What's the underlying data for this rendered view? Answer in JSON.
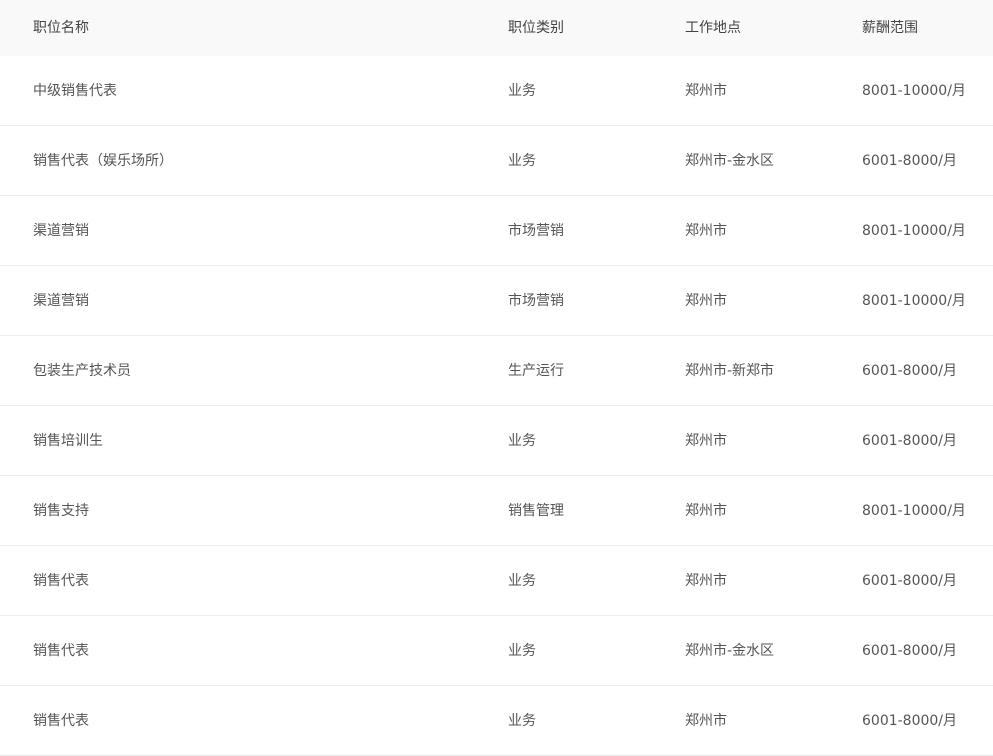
{
  "table": {
    "headers": {
      "title": "职位名称",
      "category": "职位类别",
      "location": "工作地点",
      "salary": "薪酬范围"
    },
    "rows": [
      {
        "title": "中级销售代表",
        "category": "业务",
        "location": "郑州市",
        "salary": "8001-10000/月"
      },
      {
        "title": "销售代表（娱乐场所）",
        "category": "业务",
        "location": "郑州市-金水区",
        "salary": "6001-8000/月"
      },
      {
        "title": "渠道营销",
        "category": "市场营销",
        "location": "郑州市",
        "salary": "8001-10000/月"
      },
      {
        "title": "渠道营销",
        "category": "市场营销",
        "location": "郑州市",
        "salary": "8001-10000/月"
      },
      {
        "title": "包装生产技术员",
        "category": "生产运行",
        "location": "郑州市-新郑市",
        "salary": "6001-8000/月"
      },
      {
        "title": "销售培训生",
        "category": "业务",
        "location": "郑州市",
        "salary": "6001-8000/月"
      },
      {
        "title": "销售支持",
        "category": "销售管理",
        "location": "郑州市",
        "salary": "8001-10000/月"
      },
      {
        "title": "销售代表",
        "category": "业务",
        "location": "郑州市",
        "salary": "6001-8000/月"
      },
      {
        "title": "销售代表",
        "category": "业务",
        "location": "郑州市-金水区",
        "salary": "6001-8000/月"
      },
      {
        "title": "销售代表",
        "category": "业务",
        "location": "郑州市",
        "salary": "6001-8000/月"
      }
    ]
  }
}
